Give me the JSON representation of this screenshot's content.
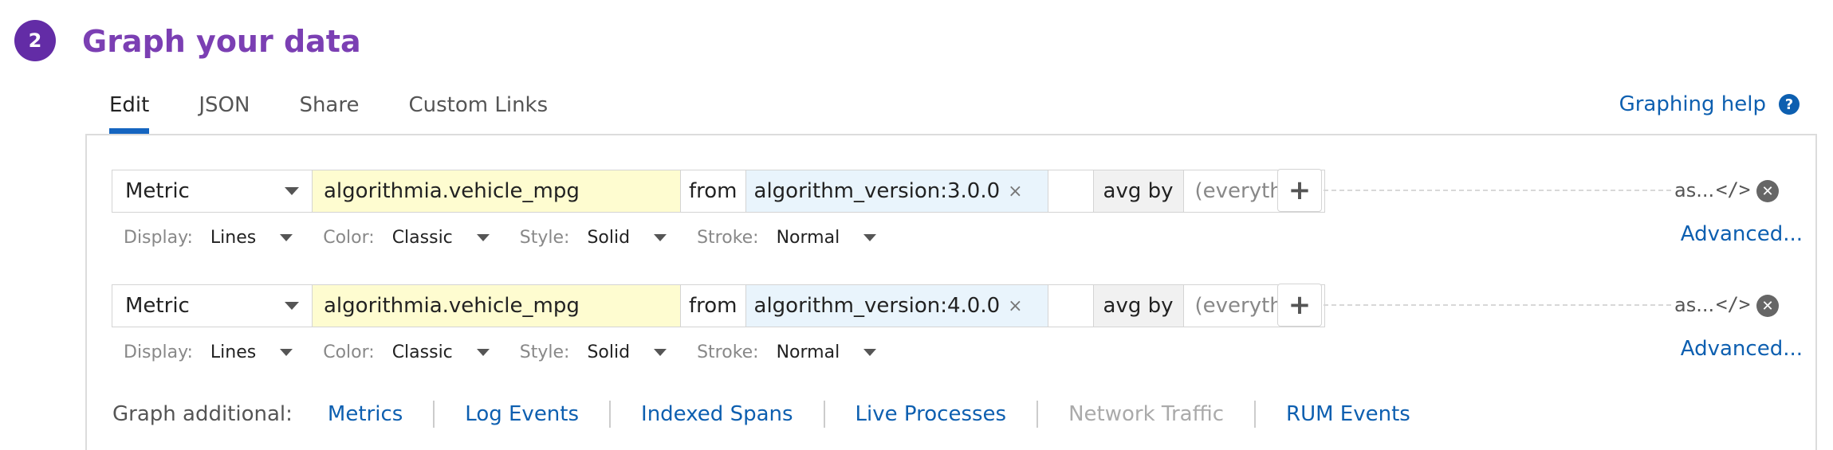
{
  "section": {
    "step": "2",
    "title": "Graph your data"
  },
  "tabs": [
    {
      "label": "Edit",
      "active": true
    },
    {
      "label": "JSON",
      "active": false
    },
    {
      "label": "Share",
      "active": false
    },
    {
      "label": "Custom Links",
      "active": false
    }
  ],
  "help": {
    "label": "Graphing help",
    "icon": "?"
  },
  "queries": [
    {
      "type": "Metric",
      "metric": "algorithmia.vehicle_mpg",
      "from_label": "from",
      "tag": "algorithm_version:3.0.0",
      "tag_remove": "×",
      "avg_label": "avg by",
      "avg_value": "(everything)",
      "alias": "as...",
      "code_icon": "</>",
      "remove_icon": "✕",
      "add_icon": "+",
      "display": {
        "label": "Display:",
        "value": "Lines"
      },
      "color": {
        "label": "Color:",
        "value": "Classic"
      },
      "style": {
        "label": "Style:",
        "value": "Solid"
      },
      "stroke": {
        "label": "Stroke:",
        "value": "Normal"
      },
      "advanced": "Advanced..."
    },
    {
      "type": "Metric",
      "metric": "algorithmia.vehicle_mpg",
      "from_label": "from",
      "tag": "algorithm_version:4.0.0",
      "tag_remove": "×",
      "avg_label": "avg by",
      "avg_value": "(everything)",
      "alias": "as...",
      "code_icon": "</>",
      "remove_icon": "✕",
      "add_icon": "+",
      "display": {
        "label": "Display:",
        "value": "Lines"
      },
      "color": {
        "label": "Color:",
        "value": "Classic"
      },
      "style": {
        "label": "Style:",
        "value": "Solid"
      },
      "stroke": {
        "label": "Stroke:",
        "value": "Normal"
      },
      "advanced": "Advanced..."
    }
  ],
  "graph_additional": {
    "label": "Graph additional:",
    "links": [
      {
        "label": "Metrics",
        "enabled": true
      },
      {
        "label": "Log Events",
        "enabled": true
      },
      {
        "label": "Indexed Spans",
        "enabled": true
      },
      {
        "label": "Live Processes",
        "enabled": true
      },
      {
        "label": "Network Traffic",
        "enabled": false
      },
      {
        "label": "RUM Events",
        "enabled": true
      }
    ]
  }
}
